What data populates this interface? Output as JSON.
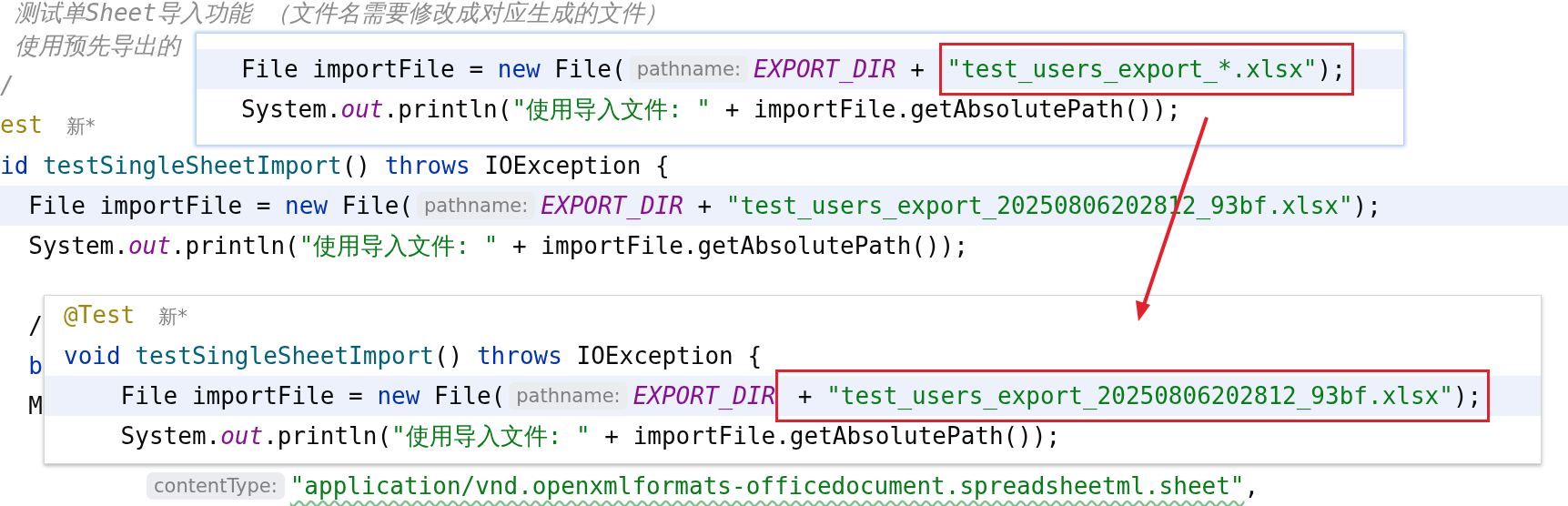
{
  "editor": {
    "lines": [
      {
        "highlighted": false,
        "segments": [
          {
            "kind": "code",
            "tokens": [
              {
                "kind": "comment",
                "text": " 测试单Sheet导入功能 （文件名需要修改成对应生成的文件）"
              }
            ]
          }
        ]
      },
      {
        "highlighted": false,
        "segments": [
          {
            "kind": "code",
            "tokens": [
              {
                "kind": "comment",
                "text": " 使用预先导出的"
              }
            ]
          }
        ]
      },
      {
        "highlighted": false,
        "segments": [
          {
            "kind": "code",
            "tokens": [
              {
                "kind": "comment",
                "text": "/"
              }
            ]
          }
        ]
      },
      {
        "highlighted": false,
        "segments": [
          {
            "kind": "code",
            "tokens": [
              {
                "kind": "annotation",
                "text": "est"
              },
              {
                "kind": "inlay",
                "text": "新*"
              }
            ]
          }
        ]
      },
      {
        "highlighted": false,
        "segments": [
          {
            "kind": "code",
            "tokens": [
              {
                "kind": "keyword",
                "text": "id"
              },
              {
                "kind": "method",
                "text": " testSingleSheetImport"
              },
              {
                "kind": "plain",
                "text": "() "
              },
              {
                "kind": "keyword",
                "text": "throws"
              },
              {
                "kind": "plain",
                "text": " IOException {"
              }
            ]
          }
        ]
      },
      {
        "highlighted": true,
        "segments": [
          {
            "kind": "code",
            "tokens": [
              {
                "kind": "plain",
                "text": "  File importFile = "
              },
              {
                "kind": "keyword",
                "text": "new"
              },
              {
                "kind": "plain",
                "text": " File("
              }
            ]
          },
          {
            "kind": "hint",
            "text": "pathname:"
          },
          {
            "kind": "code",
            "tokens": [
              {
                "kind": "static",
                "text": "EXPORT_DIR"
              },
              {
                "kind": "plain",
                "text": " + "
              },
              {
                "kind": "string",
                "text": "\"test_users_export_20250806202812_93bf.xlsx\""
              },
              {
                "kind": "plain",
                "text": ");"
              }
            ]
          }
        ]
      },
      {
        "highlighted": false,
        "segments": [
          {
            "kind": "code",
            "tokens": [
              {
                "kind": "plain",
                "text": "  System."
              },
              {
                "kind": "static",
                "text": "out"
              },
              {
                "kind": "plain",
                "text": ".println("
              },
              {
                "kind": "string",
                "text": "\"使用导入文件: \""
              },
              {
                "kind": "plain",
                "text": " + importFile.getAbsolutePath());"
              }
            ]
          }
        ]
      },
      {
        "highlighted": false
      },
      {
        "highlighted": false,
        "segments": [
          {
            "kind": "code",
            "tokens": [
              {
                "kind": "plain",
                "text": "  /"
              }
            ]
          }
        ]
      },
      {
        "highlighted": false,
        "segments": [
          {
            "kind": "code",
            "tokens": [
              {
                "kind": "keyword",
                "text": "  b"
              }
            ]
          }
        ]
      },
      {
        "highlighted": false,
        "segments": [
          {
            "kind": "code",
            "tokens": [
              {
                "kind": "plain",
                "text": "  M"
              }
            ]
          }
        ]
      },
      {
        "highlighted": false
      },
      {
        "highlighted": false,
        "kind": "continuation",
        "segments": [
          {
            "kind": "hint",
            "text": "contentType:"
          },
          {
            "kind": "code",
            "tokens": [
              {
                "kind": "typo",
                "text": "\"application/vnd.openxmlformats-officedocument.spreadsheetml.sheet\""
              },
              {
                "kind": "plain",
                "text": ","
              }
            ]
          }
        ]
      }
    ]
  },
  "popups": [
    {
      "lines": [
        {
          "highlighted": true,
          "segments": [
            {
              "kind": "code",
              "tokens": [
                {
                  "kind": "plain",
                  "text": "   File importFile = "
                },
                {
                  "kind": "keyword",
                  "text": "new"
                },
                {
                  "kind": "plain",
                  "text": " File("
                }
              ]
            },
            {
              "kind": "hint",
              "text": "pathname:"
            },
            {
              "kind": "code",
              "tokens": [
                {
                  "kind": "static",
                  "text": "EXPORT_DIR"
                },
                {
                  "kind": "plain",
                  "text": " + "
                }
              ]
            },
            {
              "kind": "boxed",
              "tokens": [
                {
                  "kind": "string",
                  "text": "\"test_users_export_*.xlsx\""
                },
                {
                  "kind": "plain",
                  "text": ");"
                }
              ]
            }
          ]
        },
        {
          "highlighted": false,
          "segments": [
            {
              "kind": "code",
              "tokens": [
                {
                  "kind": "plain",
                  "text": "   System."
                },
                {
                  "kind": "static",
                  "text": "out"
                },
                {
                  "kind": "plain",
                  "text": ".println("
                },
                {
                  "kind": "string",
                  "text": "\"使用导入文件: \""
                },
                {
                  "kind": "plain",
                  "text": " + importFile.getAbsolutePath());"
                }
              ]
            }
          ]
        }
      ]
    },
    {
      "lines": [
        {
          "highlighted": false,
          "segments": [
            {
              "kind": "code",
              "tokens": [
                {
                  "kind": "annotation",
                  "text": "@Test"
                },
                {
                  "kind": "inlay",
                  "text": "新*"
                }
              ]
            }
          ]
        },
        {
          "highlighted": false,
          "segments": [
            {
              "kind": "code",
              "tokens": [
                {
                  "kind": "keyword",
                  "text": "void"
                },
                {
                  "kind": "method",
                  "text": " testSingleSheetImport"
                },
                {
                  "kind": "plain",
                  "text": "() "
                },
                {
                  "kind": "keyword",
                  "text": "throws"
                },
                {
                  "kind": "plain",
                  "text": " IOException {"
                }
              ]
            }
          ]
        },
        {
          "highlighted": true,
          "segments": [
            {
              "kind": "code",
              "tokens": [
                {
                  "kind": "plain",
                  "text": "    File importFile = "
                },
                {
                  "kind": "keyword",
                  "text": "new"
                },
                {
                  "kind": "plain",
                  "text": " File("
                }
              ]
            },
            {
              "kind": "hint",
              "text": "pathname:"
            },
            {
              "kind": "code",
              "tokens": [
                {
                  "kind": "static",
                  "text": "EXPORT_DIR"
                }
              ]
            },
            {
              "kind": "boxed",
              "tokens": [
                {
                  "kind": "plain",
                  "text": " + "
                },
                {
                  "kind": "string",
                  "text": "\"test_users_export_20250806202812_93bf.xlsx\""
                },
                {
                  "kind": "plain",
                  "text": ");"
                }
              ]
            }
          ]
        },
        {
          "highlighted": false,
          "segments": [
            {
              "kind": "code",
              "tokens": [
                {
                  "kind": "plain",
                  "text": "    System."
                },
                {
                  "kind": "static",
                  "text": "out"
                },
                {
                  "kind": "plain",
                  "text": ".println("
                },
                {
                  "kind": "string",
                  "text": "\"使用导入文件: \""
                },
                {
                  "kind": "plain",
                  "text": " + importFile.getAbsolutePath());"
                }
              ]
            }
          ]
        }
      ]
    }
  ]
}
